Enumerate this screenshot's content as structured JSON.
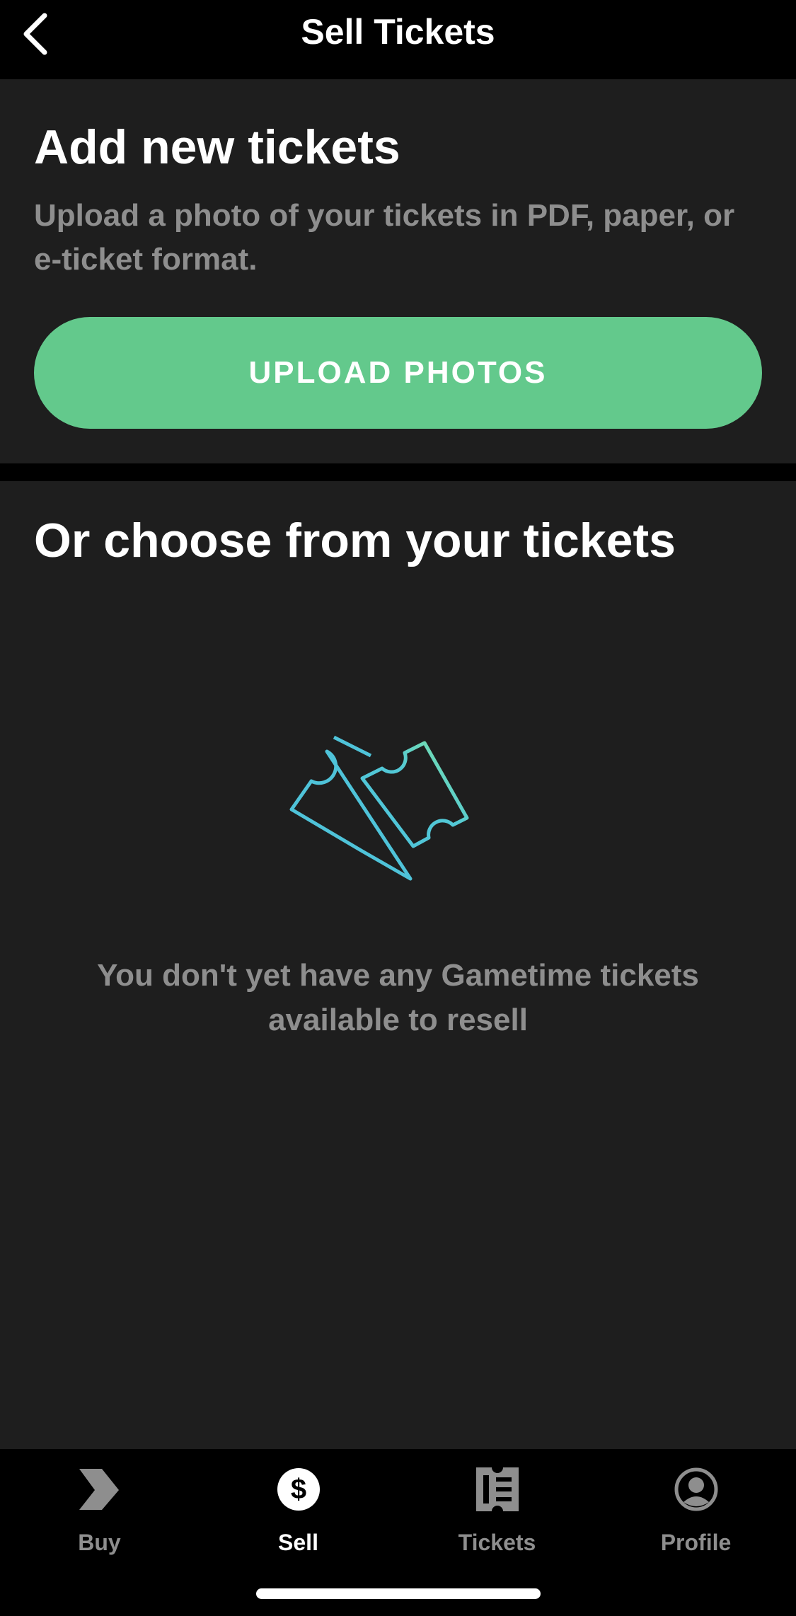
{
  "header": {
    "title": "Sell Tickets",
    "back_icon": "chevron-left-icon"
  },
  "upload_section": {
    "heading": "Add new tickets",
    "description": "Upload a photo of your tickets in PDF, paper, or e-ticket format.",
    "button_label": "UPLOAD PHOTOS"
  },
  "tickets_section": {
    "heading": "Or choose from your tickets",
    "illustration_icon": "tickets-icon",
    "empty_message": "You don't yet have any Gametime tickets available to resell"
  },
  "tab_bar": {
    "active_tab": "Sell",
    "tabs": [
      {
        "label": "Buy",
        "icon": "gametime-logo-icon"
      },
      {
        "label": "Sell",
        "icon": "dollar-icon"
      },
      {
        "label": "Tickets",
        "icon": "ticket-icon"
      },
      {
        "label": "Profile",
        "icon": "profile-icon"
      }
    ]
  },
  "colors": {
    "background": "#000000",
    "card": "#1e1e1e",
    "accent_green": "#63c98c",
    "muted_text": "#8e8e8e",
    "ticket_blue": "#4fc3d9",
    "ticket_green": "#7fe7a1"
  }
}
